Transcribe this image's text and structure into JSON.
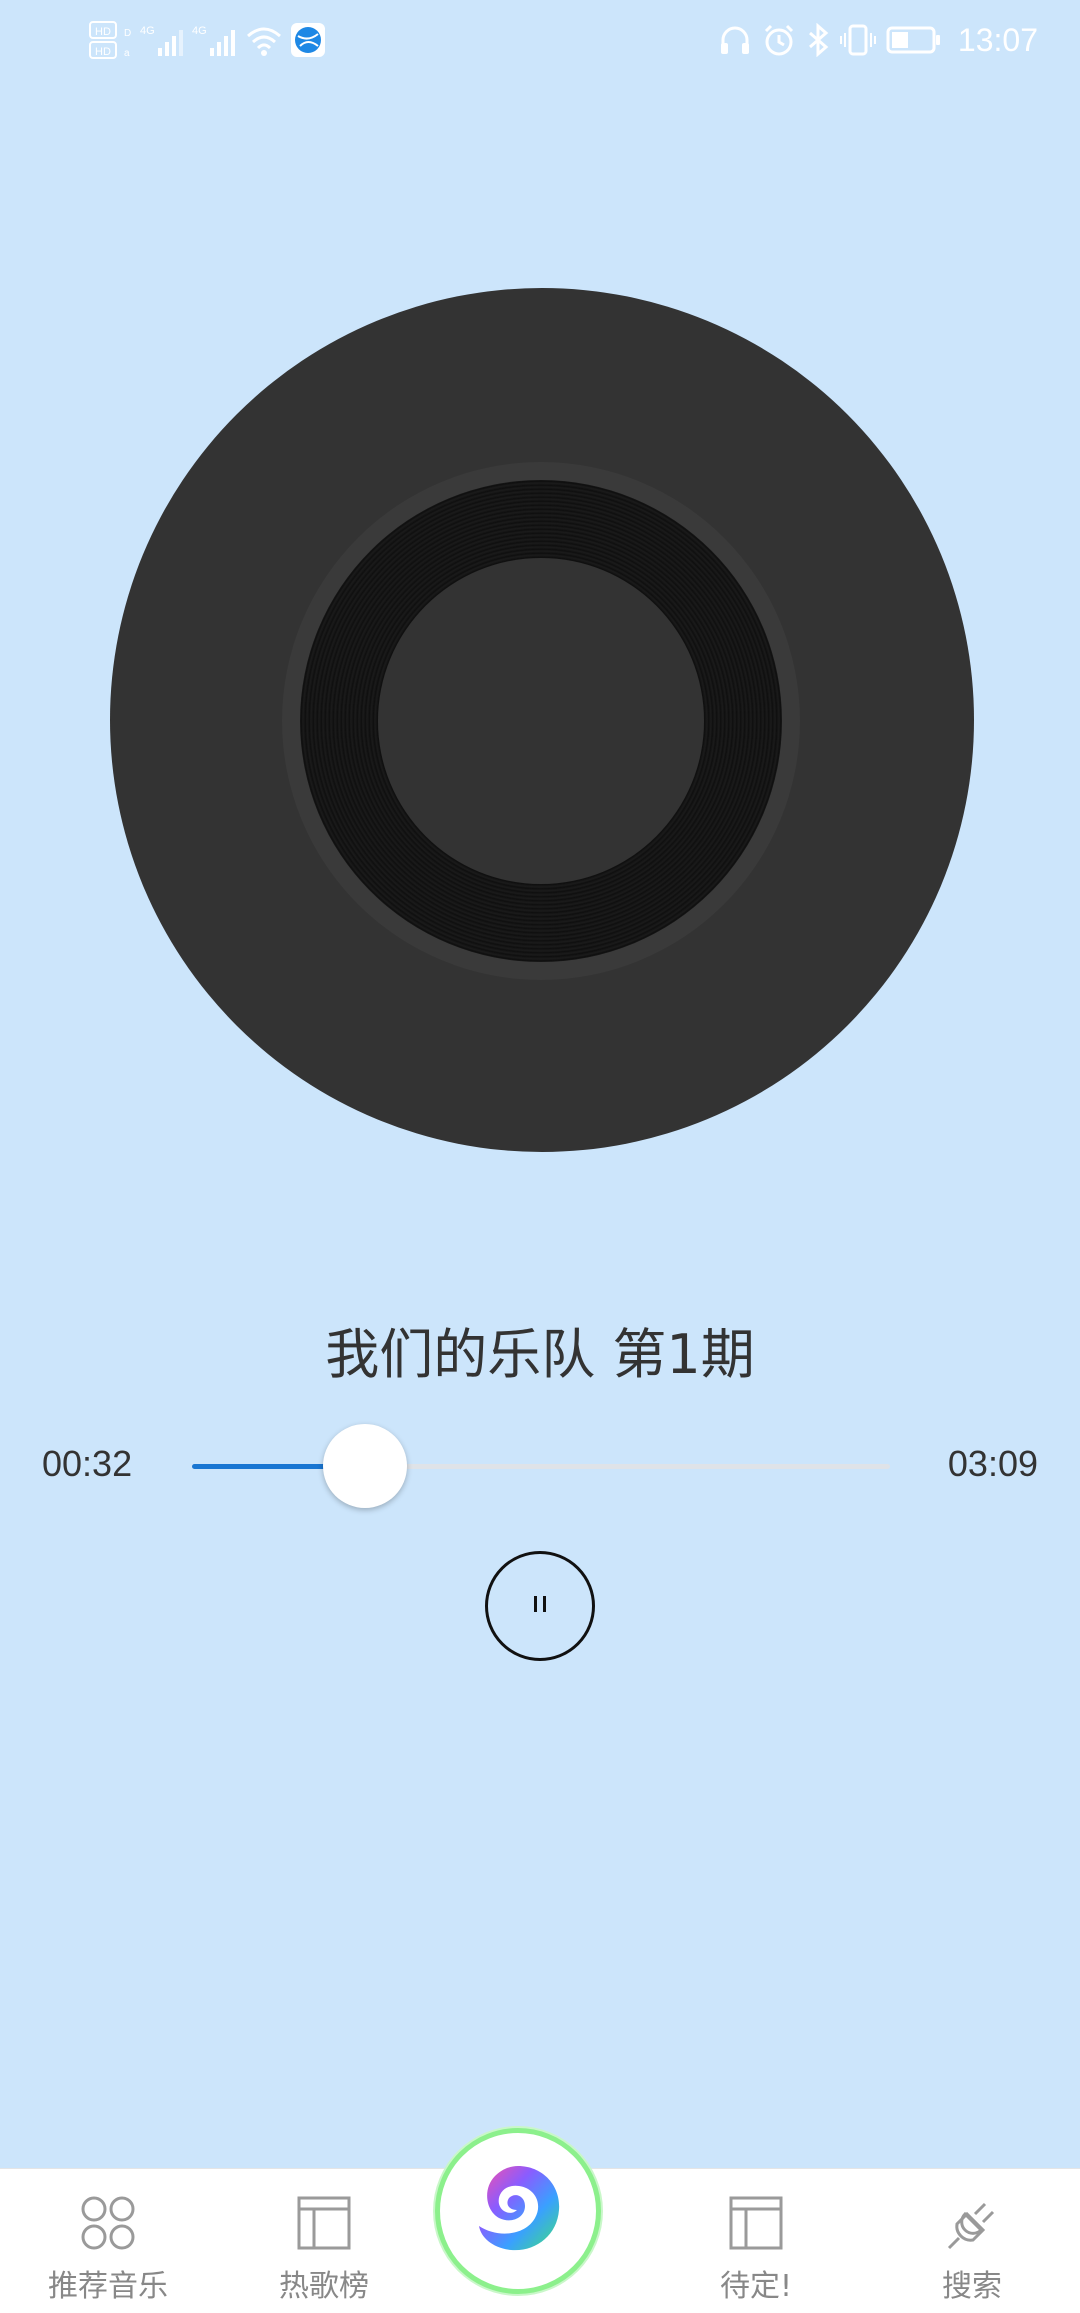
{
  "status_bar": {
    "time": "13:07",
    "left_icons": [
      "hd-icon",
      "signal-4g-icon",
      "signal-4g-icon",
      "wifi-icon",
      "browser-app-icon"
    ],
    "right_icons": [
      "headphones-icon",
      "alarm-icon",
      "bluetooth-icon",
      "vibrate-icon",
      "battery-icon"
    ]
  },
  "player": {
    "title": "我们的乐队 第1期",
    "current_time": "00:32",
    "total_time": "03:09",
    "progress": 0.2476,
    "accent_color": "#1976d2",
    "play_state_icon": "pause-icon"
  },
  "bottom_nav": {
    "items": [
      {
        "label": "推荐音乐",
        "icon": "grid-circles-icon"
      },
      {
        "label": "热歌榜",
        "icon": "layout-panel-icon"
      },
      {
        "label": "",
        "icon": "center-logo-icon"
      },
      {
        "label": "待定!",
        "icon": "layout-panel-icon"
      },
      {
        "label": "搜索",
        "icon": "plug-icon"
      }
    ]
  }
}
